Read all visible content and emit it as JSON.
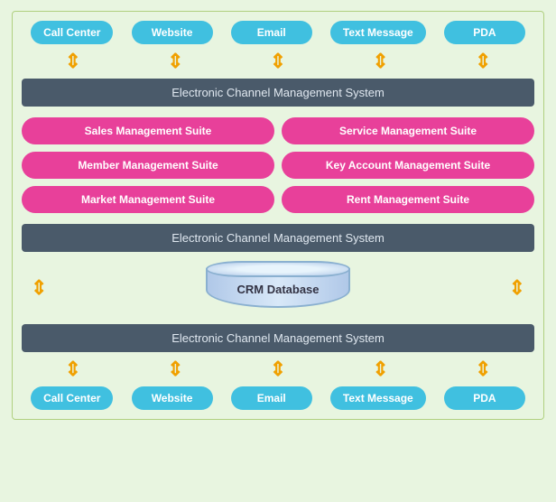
{
  "top_channels": [
    "Call Center",
    "Website",
    "Email",
    "Text Message",
    "PDA"
  ],
  "bottom_channels": [
    "Call Center",
    "Website",
    "Email",
    "Text Message",
    "PDA"
  ],
  "bar1_label": "Electronic Channel Management System",
  "bar2_label": "Electronic Channel Management System",
  "bar3_label": "Electronic Channel Management System",
  "suites": [
    "Sales Management Suite",
    "Service Management Suite",
    "Member Management Suite",
    "Key Account Management Suite",
    "Market Management Suite",
    "Rent Management Suite"
  ],
  "crm_label": "CRM Database"
}
